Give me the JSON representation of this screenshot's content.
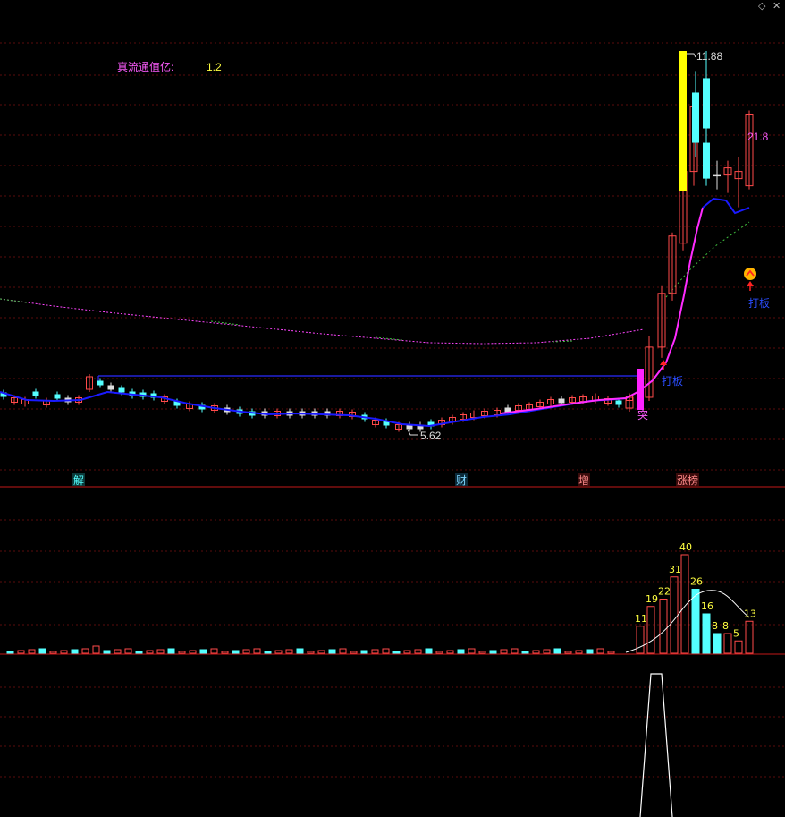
{
  "toolbar": {
    "icon_left": "diamond-icon",
    "icon_right": "close-icon",
    "diamond_glyph": "◇",
    "close_glyph": "✕"
  },
  "colors": {
    "background": "#000000",
    "grid": "#5a0d0d",
    "up": "#ff4a4a",
    "down": "#54ffff",
    "ma_line": "#1a1aff",
    "ma_boost": "#ff2bff",
    "long_ma": "#ff44ff",
    "long_ma_green": "#3fbf3f",
    "resistance": "#2a2aff",
    "label_magenta": "#ff5cff",
    "label_yellow": "#ffff40",
    "label_blue": "#2a4dff",
    "label_white": "#dddddd",
    "separator": "#c21919",
    "bar_yellow": "#ffff00",
    "bar_magenta": "#ff22ff"
  },
  "header": {
    "float_cap_label": "真流通值亿:",
    "float_cap_value": "1.2"
  },
  "main_labels": {
    "high_price": "11.88",
    "low_price": "5.62",
    "target": "21.8",
    "signal_tu": "突",
    "signal_daban_1": "打板",
    "signal_daban_2": "打板"
  },
  "event_tags": [
    "解",
    "财",
    "增",
    "涨榜"
  ],
  "chart_data": [
    {
      "type": "candlestick",
      "high_marker": 11.88,
      "low_marker": 5.62,
      "target_marker": 21.8,
      "recent_candles": [
        {
          "o": 6.9,
          "h": 7.1,
          "l": 6.85,
          "c": 7.05,
          "dir": "up"
        },
        {
          "o": 7.05,
          "h": 7.9,
          "l": 7.0,
          "c": 7.75,
          "dir": "up"
        },
        {
          "o": 7.75,
          "h": 8.6,
          "l": 7.6,
          "c": 8.5,
          "dir": "up"
        },
        {
          "o": 8.5,
          "h": 9.35,
          "l": 8.4,
          "c": 9.3,
          "dir": "up"
        },
        {
          "o": 9.2,
          "h": 10.3,
          "l": 9.1,
          "c": 10.2,
          "dir": "up"
        },
        {
          "o": 10.2,
          "h": 11.2,
          "l": 10.0,
          "c": 11.1,
          "dir": "up"
        },
        {
          "o": 10.8,
          "h": 11.88,
          "l": 10.5,
          "c": 11.5,
          "dir": "down"
        },
        {
          "o": 11.3,
          "h": 11.6,
          "l": 10.4,
          "c": 10.6,
          "dir": "down"
        },
        {
          "o": 10.6,
          "h": 10.8,
          "l": 10.0,
          "c": 10.1,
          "dir": "down"
        },
        {
          "o": 10.15,
          "h": 10.35,
          "l": 9.95,
          "c": 10.15,
          "dir": "flat"
        },
        {
          "o": 10.15,
          "h": 10.35,
          "l": 9.9,
          "c": 10.25,
          "dir": "up"
        },
        {
          "o": 10.1,
          "h": 10.4,
          "l": 9.7,
          "c": 10.2,
          "dir": "up"
        },
        {
          "o": 10.0,
          "h": 11.05,
          "l": 9.95,
          "c": 11.0,
          "dir": "up"
        }
      ]
    },
    {
      "type": "bar",
      "title": "volume",
      "labels": [
        {
          "text": "11",
          "value": 11
        },
        {
          "text": "19",
          "value": 19
        },
        {
          "text": "22",
          "value": 22
        },
        {
          "text": "31",
          "value": 31
        },
        {
          "text": "40",
          "value": 40
        },
        {
          "text": "26",
          "value": 26
        },
        {
          "text": "16",
          "value": 16
        },
        {
          "text": "8",
          "value": 8
        },
        {
          "text": "8",
          "value": 8
        },
        {
          "text": "5",
          "value": 5
        },
        {
          "text": "13",
          "value": 13
        }
      ]
    },
    {
      "type": "line",
      "title": "indicator",
      "note": "single trapezoid spike near the right end"
    }
  ]
}
